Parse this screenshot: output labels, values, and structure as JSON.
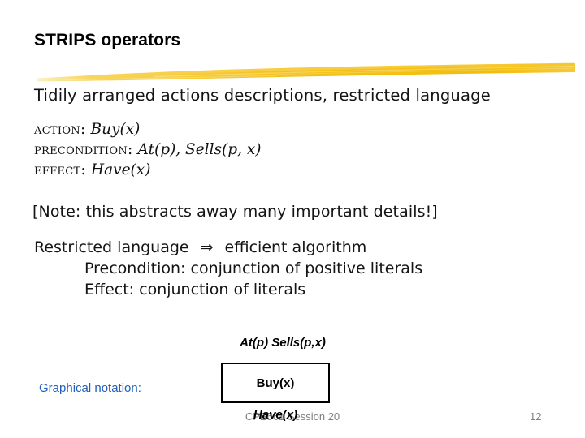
{
  "slide": {
    "title": "STRIPS operators",
    "lead": "Tidily arranged actions descriptions, restricted language",
    "schema": [
      {
        "keyword": "Action:",
        "expression": "Buy(x)"
      },
      {
        "keyword": "Precondition:",
        "expression": "At(p), Sells(p, x)"
      },
      {
        "keyword": "Effect:",
        "expression": "Have(x)"
      }
    ],
    "note": "[Note: this abstracts away many important details!]",
    "restricted": {
      "left": "Restricted language",
      "arrow": "⇒",
      "right": "efficient algorithm",
      "bullets": [
        "Precondition: conjunction of positive literals",
        "Effect: conjunction of literals"
      ]
    },
    "graphical_notation_label": "Graphical notation:",
    "diagram": {
      "preconditions": "At(p)  Sells(p,x)",
      "action": "Buy(x)",
      "effect": "Have(x)"
    },
    "footer": {
      "center": "CPE561 Session 20",
      "page": "12"
    },
    "colors": {
      "accent_blue": "#1F5FBF",
      "brush_yellow": "#F5C21A",
      "brush_yellow_light": "#F7D04E",
      "text": "#141414",
      "footer_gray": "#808080"
    }
  }
}
